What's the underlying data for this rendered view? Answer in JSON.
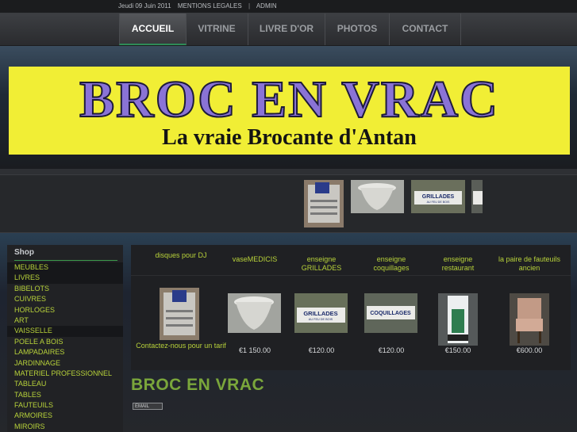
{
  "topbar": {
    "date": "Jeudi 09 Juin 2011",
    "legal": "MENTIONS LEGALES",
    "sep": "|",
    "admin": "ADMIN"
  },
  "nav": {
    "items": [
      {
        "label": "ACCUEIL"
      },
      {
        "label": "VITRINE"
      },
      {
        "label": "LIVRE D'OR"
      },
      {
        "label": "PHOTOS"
      },
      {
        "label": "CONTACT"
      }
    ]
  },
  "banner": {
    "title": "BROC EN VRAC",
    "subtitle": "La vraie Brocante d'Antan"
  },
  "shop": {
    "heading": "Shop",
    "items": [
      "MEUBLES",
      "LIVRES",
      "BIBELOTS",
      "CUIVRES",
      "HORLOGES",
      "ART",
      "VAISSELLE",
      "POELE A BOIS",
      "LAMPADAIRES",
      "JARDINNAGE",
      "MATERIEL PROFESSIONNEL",
      "TABLEAU",
      "TABLES",
      "FAUTEUILS",
      "ARMOIRES",
      "MIROIRS"
    ]
  },
  "products": [
    {
      "name": "disques pour DJ",
      "price": "",
      "contact": "Contactez-nous pour un tarif"
    },
    {
      "name": "vaseMEDICIS",
      "price": "€1 150.00"
    },
    {
      "name": "enseigne GRILLADES",
      "price": "€120.00"
    },
    {
      "name": "enseigne coquillages",
      "price": "€120.00"
    },
    {
      "name": "enseigne restaurant",
      "price": "€150.00"
    },
    {
      "name": "la paire de fauteuils ancien",
      "price": "€600.00"
    }
  ],
  "sign_texts": {
    "grillades": "GRILLADES",
    "grillades_sub": "AU FEU DE BOIS",
    "coquillages": "COQUILLAGES"
  },
  "page": {
    "title": "BROC EN VRAC",
    "email_label": "EMAIL"
  },
  "colors": {
    "accent_green": "#b8d23a",
    "banner_yellow": "#f1ee35",
    "title_green": "#7aa63b"
  }
}
